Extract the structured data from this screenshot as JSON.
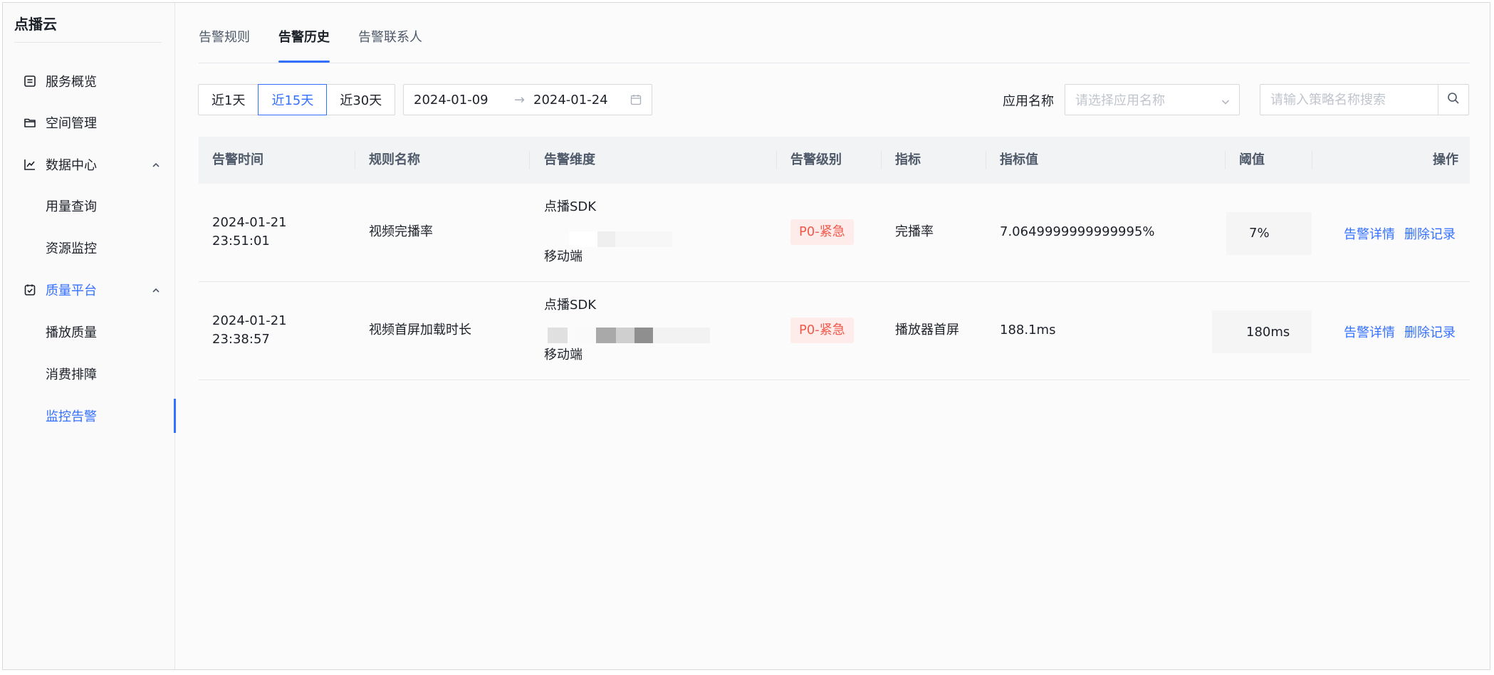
{
  "sidebar": {
    "brand": "点播云",
    "items": [
      {
        "label": "服务概览",
        "icon": "overview-icon"
      },
      {
        "label": "空间管理",
        "icon": "folder-icon"
      },
      {
        "label": "数据中心",
        "icon": "chart-line-icon",
        "expanded": true
      },
      {
        "label": "用量查询"
      },
      {
        "label": "资源监控"
      },
      {
        "label": "质量平台",
        "icon": "quality-icon",
        "expanded": true,
        "active": true
      },
      {
        "label": "播放质量"
      },
      {
        "label": "消费排障"
      },
      {
        "label": "监控告警",
        "selected": true
      }
    ]
  },
  "tabs": [
    {
      "label": "告警规则"
    },
    {
      "label": "告警历史",
      "active": true
    },
    {
      "label": "告警联系人"
    }
  ],
  "filters": {
    "ranges": [
      "近1天",
      "近15天",
      "近30天"
    ],
    "active_range": "近15天",
    "date_start": "2024-01-09",
    "date_arrow": "→",
    "date_end": "2024-01-24",
    "app_label": "应用名称",
    "app_placeholder": "请选择应用名称",
    "search_placeholder": "请输入策略名称搜索"
  },
  "table": {
    "headers": [
      "告警时间",
      "规则名称",
      "告警维度",
      "告警级别",
      "指标",
      "指标值",
      "阈值",
      "操作"
    ],
    "rows": [
      {
        "date": "2024-01-21",
        "time": "23:51:01",
        "rule": "视频完播率",
        "dim_top": "点播SDK",
        "dim_bottom": "移动端",
        "level": "P0-紧急",
        "metric": "完播率",
        "value": "7.0649999999999995%",
        "threshold": "7%",
        "action_detail": "告警详情",
        "action_delete": "删除记录"
      },
      {
        "date": "2024-01-21",
        "time": "23:38:57",
        "rule": "视频首屏加载时长",
        "dim_top": "点播SDK",
        "dim_bottom": "移动端",
        "level": "P0-紧急",
        "metric": "播放器首屏",
        "value": "188.1ms",
        "threshold": "180ms",
        "action_detail": "告警详情",
        "action_delete": "删除记录"
      }
    ]
  },
  "colors": {
    "accent": "#3370ff",
    "danger_text": "#f0594c",
    "danger_bg": "#fdecea"
  }
}
